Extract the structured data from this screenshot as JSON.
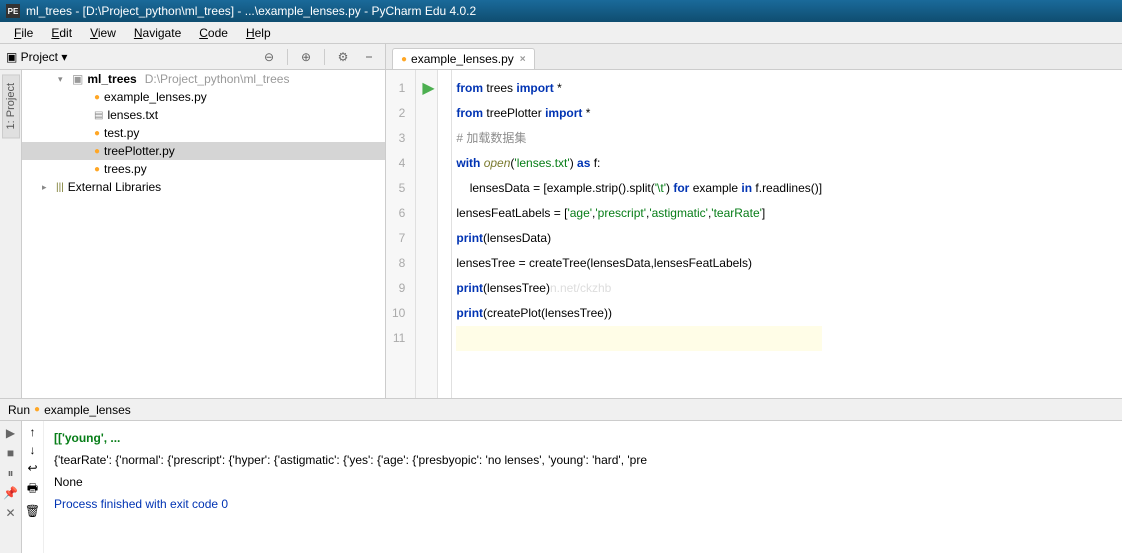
{
  "title": "ml_trees - [D:\\Project_python\\ml_trees] - ...\\example_lenses.py - PyCharm Edu 4.0.2",
  "menu": {
    "file": "File",
    "edit": "Edit",
    "view": "View",
    "navigate": "Navigate",
    "code": "Code",
    "help": "Help"
  },
  "project_panel": {
    "label": "Project",
    "vert": "1: Project"
  },
  "tree": {
    "root": {
      "name": "ml_trees",
      "path": "D:\\Project_python\\ml_trees"
    },
    "files": [
      "example_lenses.py",
      "lenses.txt",
      "test.py",
      "treePlotter.py",
      "trees.py"
    ],
    "external": "External Libraries"
  },
  "tab": {
    "name": "example_lenses.py"
  },
  "code_lines": [
    {
      "n": "1",
      "html": "<span class='kw'>from</span> trees <span class='kw'>import</span> *"
    },
    {
      "n": "2",
      "html": "<span class='kw'>from</span> treePlotter <span class='kw'>import</span> *"
    },
    {
      "n": "3",
      "html": "<span class='cmn'># 加载数据集</span>"
    },
    {
      "n": "4",
      "html": "<span class='kw'>with</span> <span class='fn'>open</span>(<span class='str'>'lenses.txt'</span>) <span class='kw'>as</span> f:"
    },
    {
      "n": "5",
      "html": "    lensesData = [example.strip().split(<span class='str'>'\\t'</span>) <span class='kw'>for</span> example <span class='kw'>in</span> f.readlines()]"
    },
    {
      "n": "6",
      "html": "lensesFeatLabels = [<span class='str'>'age'</span>,<span class='str'>'prescript'</span>,<span class='str'>'astigmatic'</span>,<span class='str'>'tearRate'</span>]"
    },
    {
      "n": "7",
      "html": "<span class='kw'>print</span>(lensesData)"
    },
    {
      "n": "8",
      "html": "lensesTree = createTree(lensesData,lensesFeatLabels)"
    },
    {
      "n": "9",
      "html": "<span class='kw'>print</span>(lensesTree)<span class='wm'>n.net/ckzhb</span>"
    },
    {
      "n": "10",
      "html": "<span class='kw'>print</span>(createPlot(lensesTree))"
    },
    {
      "n": "11",
      "html": ""
    }
  ],
  "run": {
    "label": "Run",
    "config": "example_lenses",
    "output": [
      {
        "cls": "out-green",
        "text": "[['young', ..."
      },
      {
        "cls": "",
        "text": "{'tearRate': {'normal': {'prescript': {'hyper': {'astigmatic': {'yes': {'age': {'presbyopic': 'no lenses', 'young': 'hard', 'pre"
      },
      {
        "cls": "",
        "text": "None"
      },
      {
        "cls": "",
        "text": ""
      },
      {
        "cls": "out-blue",
        "text": "Process finished with exit code 0"
      }
    ]
  }
}
